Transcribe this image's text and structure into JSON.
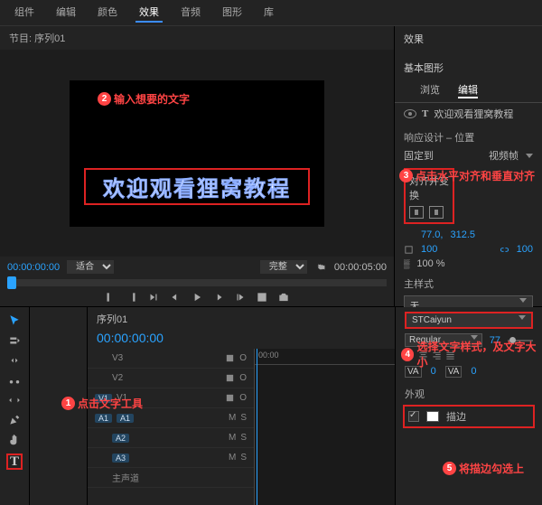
{
  "topmenu": {
    "items": [
      "组件",
      "编辑",
      "颜色",
      "效果",
      "音频",
      "图形",
      "库"
    ],
    "active": 3
  },
  "sequence": {
    "label": "节目: 序列01"
  },
  "canvas_text": "欢迎观看狸窝教程",
  "callouts": {
    "c1": "点击文字工具",
    "c2": "输入想要的文字",
    "c3": "点击水平对齐和垂直对齐",
    "c4": "选择文字样式，及文字大小",
    "c5": "将描边勾选上"
  },
  "controls": {
    "tc_left": "00:00:00:00",
    "fit": "适合",
    "zoom": "完整",
    "tc_right": "00:00:05:00"
  },
  "right_panel": {
    "effects": "效果",
    "graphics": "基本图形",
    "tab_browse": "浏览",
    "tab_edit": "编辑",
    "layer_name": "欢迎观看狸窝教程",
    "responsive": "响应设计 – 位置",
    "pin": "固定到",
    "vidframe": "视频帧",
    "align": "对齐并变换",
    "anchor_x": "77.0,",
    "anchor_y": "312.5",
    "scale": "100",
    "opac_pct": "100 %",
    "opacity": "100",
    "master": "主样式",
    "master_val": "无"
  },
  "timeline": {
    "tab": "序列01",
    "tc": "00:00:00:00",
    "ruler": "00:00",
    "tracks": {
      "v3": "V3",
      "v2": "V2",
      "v1": "V1",
      "a1l": "A1",
      "a1": "A1",
      "a2": "A2",
      "a3": "A3",
      "master": "主声道"
    },
    "m": "M",
    "s": "S",
    "o": "O"
  },
  "text_style": {
    "font": "STCaiyun",
    "weight": "Regular",
    "size": "77",
    "va": "VA",
    "va2": "VA",
    "appearance": "外观",
    "stroke": "描边"
  }
}
